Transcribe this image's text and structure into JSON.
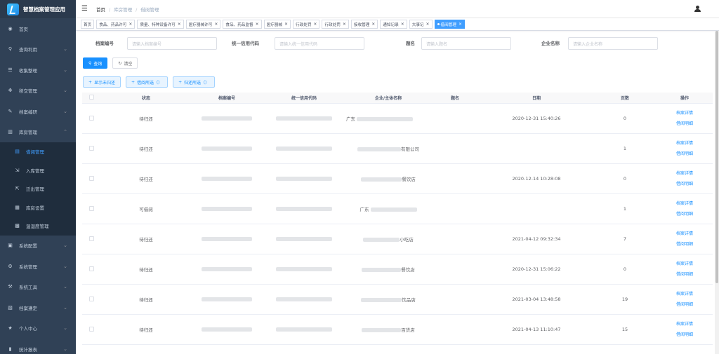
{
  "app_title": "智慧档案管理应用",
  "sidebar": {
    "items": [
      {
        "label": "首页",
        "icon": "dashboard-icon",
        "arrow": false
      },
      {
        "label": "查询利用",
        "icon": "search-icon",
        "arrow": true
      },
      {
        "label": "收集整理",
        "icon": "list-icon",
        "arrow": true
      },
      {
        "label": "移交管理",
        "icon": "move-icon",
        "arrow": true
      },
      {
        "label": "档案编研",
        "icon": "edit-icon",
        "arrow": true
      },
      {
        "label": "库房管理",
        "icon": "warehouse-icon",
        "arrow": true,
        "open": true
      }
    ],
    "sub_items": [
      {
        "label": "借阅管理",
        "icon": "borrow-icon",
        "active": true
      },
      {
        "label": "入库管理",
        "icon": "inbound-icon"
      },
      {
        "label": "迁出管理",
        "icon": "outbound-icon"
      },
      {
        "label": "库房设置",
        "icon": "settings-icon"
      },
      {
        "label": "温湿度管理",
        "icon": "thermo-icon"
      }
    ],
    "bottom_items": [
      {
        "label": "系统配置",
        "icon": "config-icon"
      },
      {
        "label": "系统管理",
        "icon": "gear-icon"
      },
      {
        "label": "系统工具",
        "icon": "tool-icon"
      },
      {
        "label": "档案遵定",
        "icon": "stamp-icon"
      },
      {
        "label": "个人中心",
        "icon": "star-icon"
      },
      {
        "label": "统计报表",
        "icon": "chart-icon"
      }
    ]
  },
  "breadcrumb": [
    "首页",
    "库房管理",
    "借阅管理"
  ],
  "tags": [
    {
      "label": "首页",
      "closable": false
    },
    {
      "label": "食品、药品许可",
      "closable": true
    },
    {
      "label": "质量、特种设备许可",
      "closable": true
    },
    {
      "label": "医疗器械许可",
      "closable": true
    },
    {
      "label": "食品、药品监督",
      "closable": true
    },
    {
      "label": "医疗器械",
      "closable": true
    },
    {
      "label": "行政处罚",
      "closable": true
    },
    {
      "label": "行政处罚",
      "closable": true
    },
    {
      "label": "接收管理",
      "closable": true
    },
    {
      "label": "通知记录",
      "closable": true
    },
    {
      "label": "大事记",
      "closable": true
    },
    {
      "label": "借阅管理",
      "closable": true,
      "active": true
    }
  ],
  "search": {
    "fields": [
      {
        "label": "档案编号",
        "placeholder": "请输入档案编号"
      },
      {
        "label": "统一信用代码",
        "placeholder": "请输入统一信用代码"
      },
      {
        "label": "题名",
        "placeholder": "请输入题名"
      },
      {
        "label": "企业名称",
        "placeholder": "请输入企业名称"
      }
    ],
    "query_button": "查询",
    "reset_button": "清空"
  },
  "actions": {
    "show_unreturned": "显示未归还",
    "borrow_selected": "借阅所选（）",
    "return_selected": "归还所选（）"
  },
  "table": {
    "columns": [
      "状态",
      "档案编号",
      "统一信用代码",
      "企业/主体名称",
      "题名",
      "日期",
      "页数",
      "操作"
    ],
    "rows": [
      {
        "status": "待归还",
        "company_text": "广东",
        "date": "2020-12-31 15:40:26",
        "pages": "0"
      },
      {
        "status": "待归还",
        "company_text": "有限公司",
        "date": "",
        "pages": "1"
      },
      {
        "status": "待归还",
        "company_text": "餐饮店",
        "date": "2020-12-14 10:28:08",
        "pages": "0"
      },
      {
        "status": "可借阅",
        "company_text": "广东",
        "date": "",
        "pages": "1"
      },
      {
        "status": "待归还",
        "company_text": "小吃店",
        "date": "2021-04-12 09:32:34",
        "pages": "7"
      },
      {
        "status": "待归还",
        "company_text": "餐饮店",
        "date": "2020-12-31 15:06:22",
        "pages": "0"
      },
      {
        "status": "待归还",
        "company_text": "饮品店",
        "date": "2021-03-04 13:48:58",
        "pages": "19"
      },
      {
        "status": "待归还",
        "company_text": "百货店",
        "date": "2021-04-13 11:10:47",
        "pages": "15"
      }
    ],
    "op_detail": "档案详情",
    "op_borrow": "借阅明细"
  }
}
